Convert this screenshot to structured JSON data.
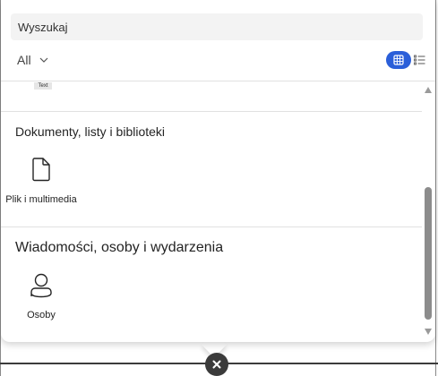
{
  "search": {
    "placeholder": "Wyszukaj"
  },
  "filter": {
    "selected": "All"
  },
  "partial_tile": {
    "label": "Text"
  },
  "sections": [
    {
      "title": "Dokumenty, listy i biblioteki",
      "items": [
        {
          "label": "Plik i multimedia",
          "icon": "file-icon"
        }
      ]
    },
    {
      "title": "Wiadomości, osoby i wydarzenia",
      "items": [
        {
          "label": "Osoby",
          "icon": "person-icon"
        }
      ]
    }
  ],
  "colors": {
    "accent": "#2b5fd9",
    "scrollbar_thumb": "#8c8c8c",
    "close_button": "#3b3b3b"
  }
}
